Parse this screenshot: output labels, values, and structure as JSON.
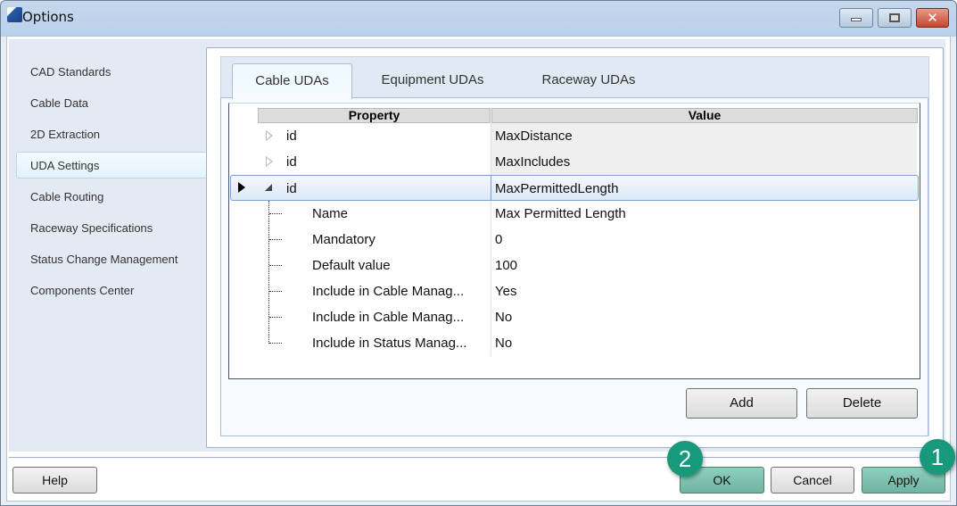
{
  "window": {
    "title": "Options"
  },
  "sidebar": {
    "items": [
      {
        "label": "CAD Standards"
      },
      {
        "label": "Cable Data"
      },
      {
        "label": "2D Extraction"
      },
      {
        "label": "UDA Settings",
        "selected": true
      },
      {
        "label": "Cable Routing"
      },
      {
        "label": "Raceway Specifications"
      },
      {
        "label": "Status Change Management"
      },
      {
        "label": "Components Center"
      }
    ]
  },
  "tabs": [
    {
      "label": "Cable UDAs",
      "active": true
    },
    {
      "label": "Equipment UDAs"
    },
    {
      "label": "Raceway UDAs"
    }
  ],
  "grid": {
    "headers": {
      "property": "Property",
      "value": "Value"
    },
    "rows": [
      {
        "property": "id",
        "value": "MaxDistance"
      },
      {
        "property": "id",
        "value": "MaxIncludes"
      },
      {
        "property": "id",
        "value": "MaxPermittedLength"
      }
    ],
    "children": [
      {
        "property": "Name",
        "value": "Max Permitted Length"
      },
      {
        "property": "Mandatory",
        "value": "0"
      },
      {
        "property": "Default value",
        "value": "100"
      },
      {
        "property": "Include in Cable Manag...",
        "value": "Yes"
      },
      {
        "property": "Include in Cable Manag...",
        "value": "No"
      },
      {
        "property": "Include in Status Manag...",
        "value": "No"
      }
    ]
  },
  "buttons": {
    "add": "Add",
    "delete": "Delete",
    "help": "Help",
    "ok": "OK",
    "cancel": "Cancel",
    "apply": "Apply"
  },
  "badges": {
    "ok": "2",
    "apply": "1"
  },
  "colors": {
    "badge": "#18997b",
    "highlight": "#7fc4b2"
  }
}
